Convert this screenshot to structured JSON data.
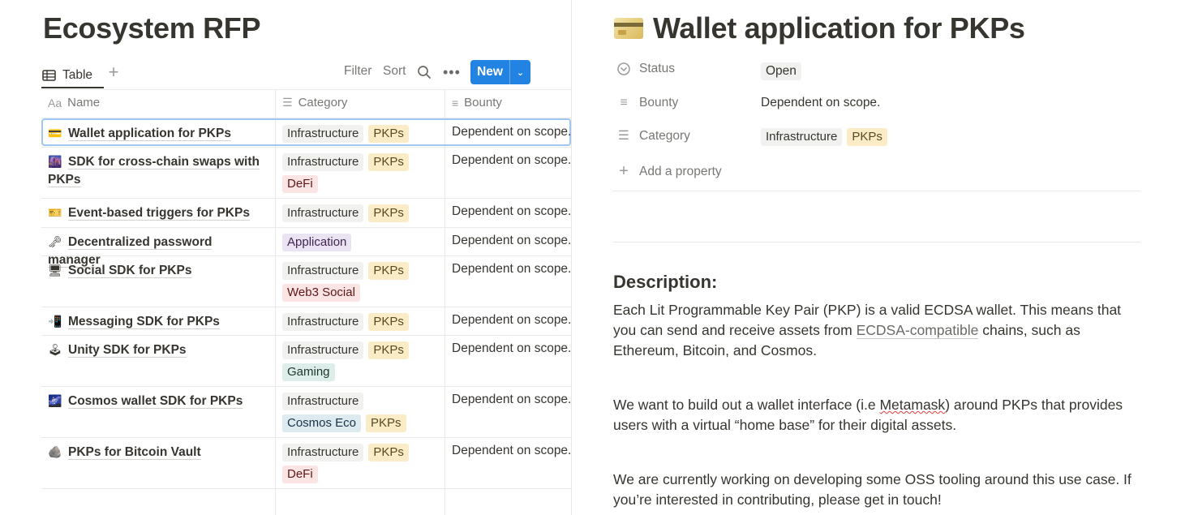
{
  "left": {
    "page_title": "Ecosystem RFP",
    "view_tab_label": "Table",
    "add_view_symbol": "+",
    "toolbar": {
      "filter": "Filter",
      "sort": "Sort",
      "more": "•••",
      "new": "New"
    },
    "columns": {
      "name": "Name",
      "category": "Category",
      "bounty": "Bounty"
    },
    "rows": [
      {
        "emoji": "💳",
        "icon": "credit-card-icon",
        "name": "Wallet application for PKPs",
        "tags": [
          "Infrastructure",
          "PKPs"
        ],
        "bounty": "Dependent on scope."
      },
      {
        "emoji": "🌆",
        "icon": "cityscape-icon",
        "name": "SDK for cross-chain swaps with PKPs",
        "tags": [
          "Infrastructure",
          "PKPs",
          "DeFi"
        ],
        "bounty": "Dependent on scope."
      },
      {
        "emoji": "🎫",
        "icon": "ticket-icon",
        "name": "Event-based triggers for PKPs",
        "tags": [
          "Infrastructure",
          "PKPs"
        ],
        "bounty": "Dependent on scope."
      },
      {
        "emoji": "🗝",
        "icon": "key-icon",
        "name": "Decentralized password manager",
        "tags": [
          "Application"
        ],
        "bounty": "Dependent on scope."
      },
      {
        "emoji": "🖥",
        "icon": "monitor-icon",
        "name": "Social SDK for PKPs",
        "tags": [
          "Infrastructure",
          "PKPs",
          "Web3 Social"
        ],
        "bounty": "Dependent on scope."
      },
      {
        "emoji": "📲",
        "icon": "mobile-phone-icon",
        "name": "Messaging SDK for PKPs",
        "tags": [
          "Infrastructure",
          "PKPs"
        ],
        "bounty": "Dependent on scope."
      },
      {
        "emoji": "🕹",
        "icon": "joystick-icon",
        "name": "Unity SDK for PKPs",
        "tags": [
          "Infrastructure",
          "PKPs",
          "Gaming"
        ],
        "bounty": "Dependent on scope."
      },
      {
        "emoji": "🌌",
        "icon": "galaxy-icon",
        "name": "Cosmos wallet SDK for PKPs",
        "tags": [
          "Infrastructure",
          "Cosmos Eco",
          "PKPs"
        ],
        "bounty": "Dependent on scope."
      },
      {
        "emoji": "🪨",
        "icon": "rock-icon",
        "name": "PKPs for Bitcoin Vault",
        "tags": [
          "Infrastructure",
          "PKPs",
          "DeFi"
        ],
        "bounty": "Dependent on scope."
      }
    ]
  },
  "tag_colors": {
    "Infrastructure": {
      "bg": "#f1f1ef",
      "fg": "#37352f"
    },
    "PKPs": {
      "bg": "#fbecc8",
      "fg": "#5a4a1f"
    },
    "DeFi": {
      "bg": "#fbe4e4",
      "fg": "#5d1715"
    },
    "Application": {
      "bg": "#eae4f2",
      "fg": "#412454"
    },
    "Web3 Social": {
      "bg": "#fbe4e4",
      "fg": "#5d1715"
    },
    "Gaming": {
      "bg": "#ddedea",
      "fg": "#1c3829"
    },
    "Cosmos Eco": {
      "bg": "#ddebf1",
      "fg": "#183347"
    }
  },
  "detail": {
    "title": "Wallet application for PKPs",
    "props": {
      "status_label": "Status",
      "status_value": "Open",
      "bounty_label": "Bounty",
      "bounty_value": "Dependent on scope.",
      "category_label": "Category",
      "category_tags": [
        "Infrastructure",
        "PKPs"
      ],
      "add_property": "Add a property"
    },
    "description_heading": "Description:",
    "p1_a": "Each Lit Programmable Key Pair (PKP) is a valid ECDSA wallet. This means that you can send and receive assets from ",
    "p1_link": "ECDSA-compatible",
    "p1_b": " chains, such as Ethereum, Bitcoin, and Cosmos.",
    "p2_a": "We want to build out a wallet interface (i.e ",
    "p2_misspelled": "Metamask",
    "p2_b": ") around PKPs that provides users with a virtual “home base” for their digital assets.",
    "p3": "We are currently working on developing some OSS tooling around this use case. If you’re interested in contributing, please get in touch!"
  }
}
